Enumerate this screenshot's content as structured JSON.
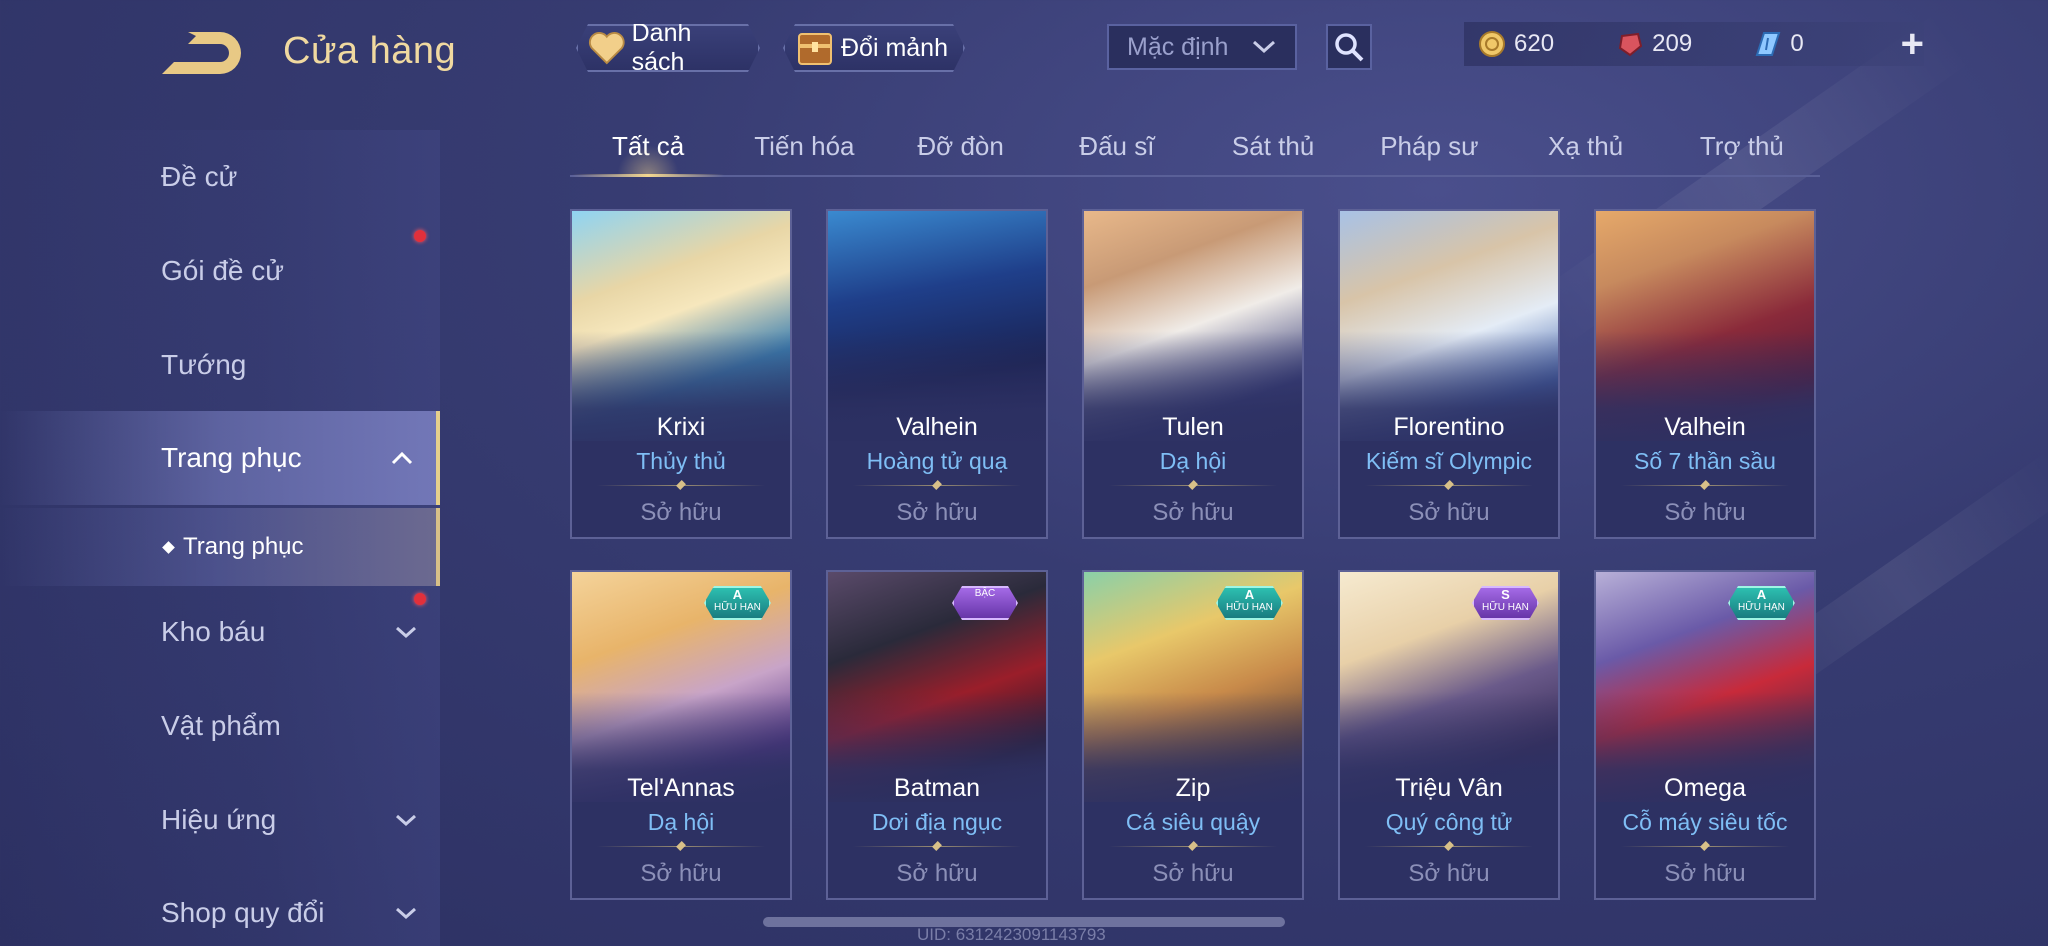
{
  "header": {
    "title": "Cửa hàng",
    "buttons": {
      "list": "Danh sách",
      "exchange": "Đổi mảnh"
    },
    "sort_select": "Mặc định",
    "currency": {
      "gold": "620",
      "voucher": "209",
      "ticket": "0"
    },
    "colors": {
      "title": "#f0d9a0",
      "accent_gold": "#e6cf8c"
    }
  },
  "sidebar": {
    "items": [
      {
        "label": "Đề cử"
      },
      {
        "label": "Gói đề cử"
      },
      {
        "label": "Tướng"
      },
      {
        "label": "Trang phục"
      },
      {
        "label": "Kho báu"
      },
      {
        "label": "Vật phẩm"
      },
      {
        "label": "Hiệu ứng"
      },
      {
        "label": "Shop quy đổi"
      }
    ],
    "sub_item": "Trang phục"
  },
  "tabs": [
    "Tất cả",
    "Tiến hóa",
    "Đỡ đòn",
    "Đấu sĩ",
    "Sát thủ",
    "Pháp sư",
    "Xạ thủ",
    "Trợ thủ"
  ],
  "cards": [
    {
      "hero": "Krixi",
      "skin": "Thủy thủ",
      "status": "Sở hữu",
      "badge": null
    },
    {
      "hero": "Valhein",
      "skin": "Hoàng tử quạ",
      "status": "Sở hữu",
      "badge": null
    },
    {
      "hero": "Tulen",
      "skin": "Dạ hội",
      "status": "Sở hữu",
      "badge": null
    },
    {
      "hero": "Florentino",
      "skin": "Kiếm sĩ Olympic",
      "status": "Sở hữu",
      "badge": null
    },
    {
      "hero": "Valhein",
      "skin": "Số 7 thần sầu",
      "status": "Sở hữu",
      "badge": null
    },
    {
      "hero": "Tel'Annas",
      "skin": "Dạ hội",
      "status": "Sở hữu",
      "badge": {
        "grade": "A",
        "text": "HỮU HẠN"
      }
    },
    {
      "hero": "Batman",
      "skin": "Dơi địa ngục",
      "status": "Sở hữu",
      "badge": {
        "grade": "",
        "text": "BẬC"
      }
    },
    {
      "hero": "Zip",
      "skin": "Cá siêu quậy",
      "status": "Sở hữu",
      "badge": {
        "grade": "A",
        "text": "HỮU HẠN"
      }
    },
    {
      "hero": "Triệu Vân",
      "skin": "Quý công tử",
      "status": "Sở hữu",
      "badge": {
        "grade": "S",
        "text": "HỮU HẠN"
      }
    },
    {
      "hero": "Omega",
      "skin": "Cỗ máy siêu tốc",
      "status": "Sở hữu",
      "badge": {
        "grade": "A",
        "text": "HỮU HẠN"
      }
    }
  ],
  "footer": {
    "uid": "UID: 6312423091143793"
  }
}
